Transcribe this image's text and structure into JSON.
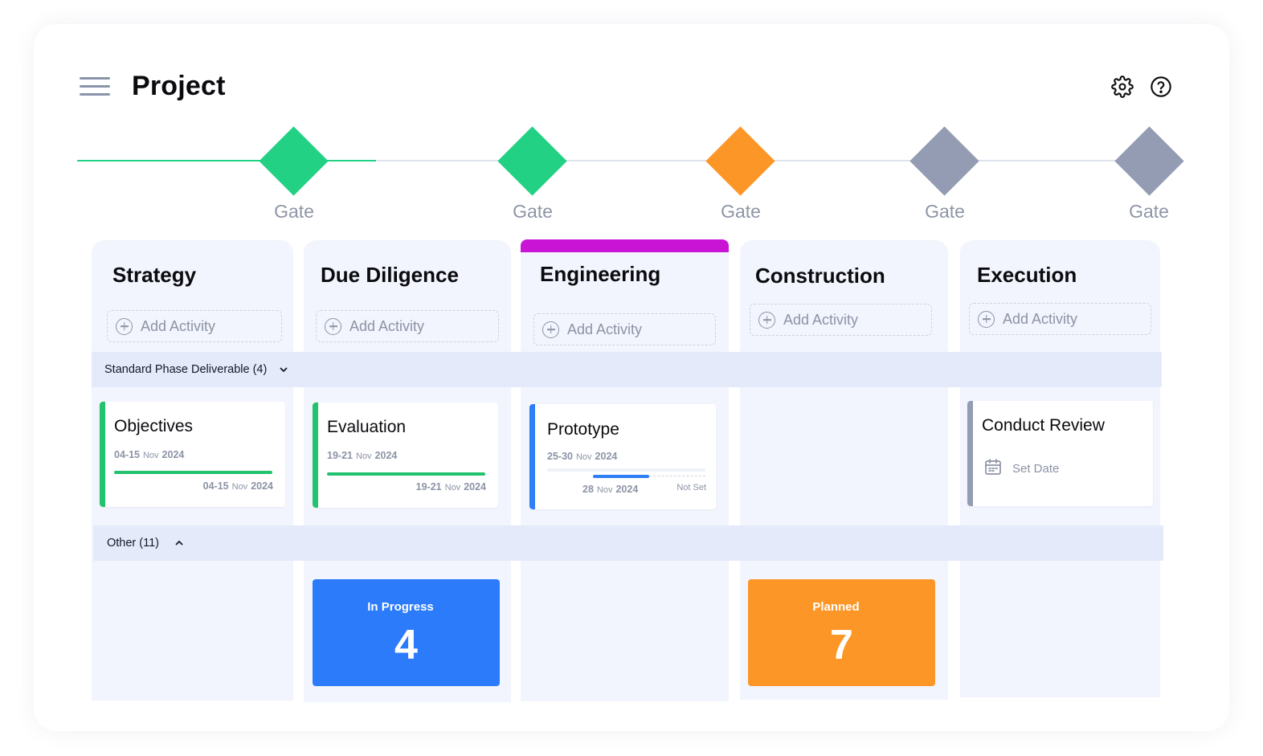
{
  "header": {
    "title": "Project",
    "menu_icon": "hamburger-menu-icon",
    "settings_icon": "gear-icon",
    "help_icon": "help-circle-icon"
  },
  "timeline": {
    "gates": [
      {
        "label": "Gate",
        "status": "complete",
        "color": "#22d184"
      },
      {
        "label": "Gate",
        "status": "complete",
        "color": "#22d184"
      },
      {
        "label": "Gate",
        "status": "active",
        "color": "#fc9626"
      },
      {
        "label": "Gate",
        "status": "upcoming",
        "color": "#939cb3"
      },
      {
        "label": "Gate",
        "status": "upcoming",
        "color": "#939cb3"
      }
    ]
  },
  "phases": [
    {
      "title": "Strategy",
      "add_label": "Add Activity"
    },
    {
      "title": "Due Diligence",
      "add_label": "Add Activity"
    },
    {
      "title": "Engineering",
      "add_label": "Add Activity",
      "accent": "#c913d5"
    },
    {
      "title": "Construction",
      "add_label": "Add Activity"
    },
    {
      "title": "Execution",
      "add_label": "Add Activity"
    }
  ],
  "groups": {
    "standard": {
      "label": "Standard Phase Deliverable (4)",
      "expanded": true
    },
    "other": {
      "label": "Other (11)",
      "expanded": false
    }
  },
  "cards": {
    "objectives": {
      "title": "Objectives",
      "planned": {
        "days": "04-15",
        "month": "Nov",
        "year": "2024"
      },
      "actual": {
        "days": "04-15",
        "month": "Nov",
        "year": "2024"
      },
      "progress": 1.0,
      "color": "#22c26f"
    },
    "evaluation": {
      "title": "Evaluation",
      "planned": {
        "days": "19-21",
        "month": "Nov",
        "year": "2024"
      },
      "actual": {
        "days": "19-21",
        "month": "Nov",
        "year": "2024"
      },
      "progress": 1.0,
      "color": "#22c26f"
    },
    "prototype": {
      "title": "Prototype",
      "planned": {
        "days": "25-30",
        "month": "Nov",
        "year": "2024"
      },
      "current": {
        "days": "28",
        "month": "Nov",
        "year": "2024"
      },
      "end_label": "Not Set",
      "progress": 0.5,
      "color": "#2d7ef7"
    },
    "conduct_review": {
      "title": "Conduct Review",
      "set_date_label": "Set Date",
      "calendar_icon": "calendar-icon",
      "color": "#939cb3"
    }
  },
  "tiles": {
    "in_progress": {
      "label": "In Progress",
      "count": "4",
      "color": "#2b7bfa"
    },
    "planned": {
      "label": "Planned",
      "count": "7",
      "color": "#fc9626"
    }
  }
}
